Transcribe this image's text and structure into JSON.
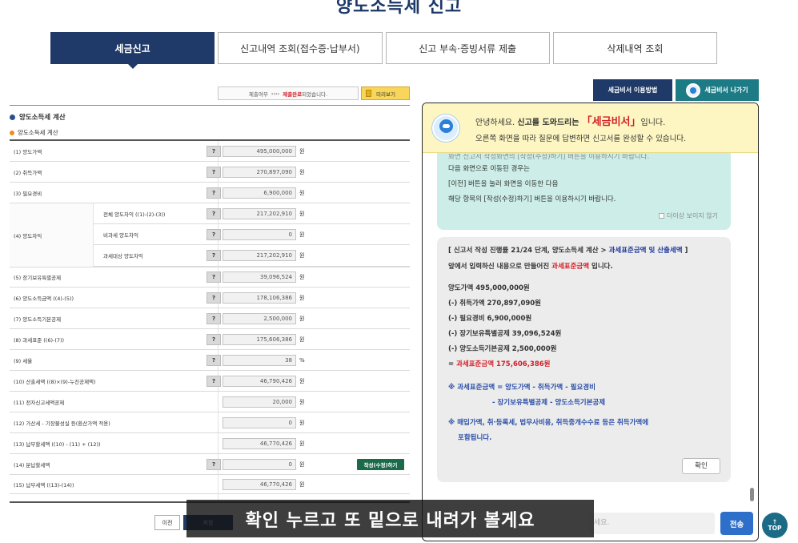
{
  "page": {
    "title": "양도소득세 신고"
  },
  "tabs": [
    {
      "label": "세금신고"
    },
    {
      "label": "신고내역 조회(접수증·납부서)"
    },
    {
      "label": "신고 부속·증빙서류 제출"
    },
    {
      "label": "삭제내역 조회"
    }
  ],
  "status": {
    "prefix": "제출여부",
    "arrows": "››››",
    "done": "제출완료",
    "suffix": "되었습니다."
  },
  "preview_label": "미리보기",
  "section_title": "양도소득세 계산",
  "sub_title": "양도소득세 계산",
  "form": {
    "rows": [
      {
        "label": "(1) 양도가액",
        "value": "495,000,000",
        "unit": "원"
      },
      {
        "label": "(2) 취득가액",
        "value": "270,897,090",
        "unit": "원"
      },
      {
        "label": "(3) 필요경비",
        "value": "6,900,000",
        "unit": "원"
      },
      {
        "label": "(4) 양도차익"
      },
      {
        "sublabel": "전체 양도차익 ((1)-(2)-(3))",
        "value": "217,202,910",
        "unit": "원"
      },
      {
        "sublabel": "비과세 양도차익",
        "value": "0",
        "unit": "원"
      },
      {
        "sublabel": "과세대상 양도차익",
        "value": "217,202,910",
        "unit": "원"
      },
      {
        "label": "(5) 장기보유특별공제",
        "value": "39,096,524",
        "unit": "원"
      },
      {
        "label": "(6) 양도소득금액 ((4)-(5))",
        "value": "178,106,386",
        "unit": "원"
      },
      {
        "label": "(7) 양도소득기본공제",
        "value": "2,500,000",
        "unit": "원"
      },
      {
        "label": "(8) 과세표준 ((6)-(7))",
        "value": "175,606,386",
        "unit": "원"
      },
      {
        "label": "(9) 세율",
        "value": "38",
        "unit": "%"
      },
      {
        "label": "(10) 산출세액 ((8)×(9)-누진공제액)",
        "value": "46,790,426",
        "unit": "원"
      },
      {
        "label": "(11) 전자신고세액공제",
        "value": "20,000",
        "unit": "원"
      },
      {
        "label": "(12) 가산세 - 기장불성실 등(환산가액 적용)",
        "value": "0",
        "unit": "원"
      },
      {
        "label": "(13) 납부할세액 ((10) - (11) + (12))",
        "value": "46,770,426",
        "unit": "원"
      },
      {
        "label": "(14) 분납할세액",
        "value": "0",
        "unit": "원",
        "action": "작성(수정)하기"
      },
      {
        "label": "(15) 납부세액 ((13)-(14))",
        "value": "46,770,426",
        "unit": "원"
      }
    ],
    "help_label": "?"
  },
  "nav": {
    "prev": "이전",
    "next": "저장"
  },
  "right": {
    "guide_button": "세금비서 이용방법",
    "exit_button": "세금비서 나가기",
    "header": {
      "greet": "안녕하세요.",
      "help": "신고를 도와드리는",
      "brand": "「세금비서」",
      "end": "입니다.",
      "line2": "오른쪽 화면을 따라 질문에 답변하면 신고서를 완성할 수 있습니다."
    },
    "teal_bubble": {
      "faded": "화면 신고서 작성화면의 [작성(수정)하기] 버튼을 이용하시기 바랍니다.",
      "line1": "다음 화면으로 이동된 경우는",
      "line2": "[이전] 버튼을 눌러 화면을 이동한 다음",
      "line3": "해당 항목의 [작성(수정)하기] 버튼을 이용하시기 바랍니다.",
      "no_more": "더이상 보이지 않기"
    },
    "grey_bubble": {
      "step_prefix": "[ 신고서 작성 진행률 21/24 단계, 양도소득세 계산 > ",
      "step_link": "과세표준금액 및 산출세액",
      "step_suffix": " ]",
      "intro_prefix": "앞에서 입력하신 내용으로 만들어진 ",
      "intro_red": "과세표준금액",
      "intro_suffix": " 입니다.",
      "calc": [
        "양도가액 495,000,000원",
        "(-) 취득가액 270,897,090원",
        "(-) 필요경비 6,900,000원",
        "(-) 장기보유특별공제 39,096,524원",
        "(-) 양도소득기본공제 2,500,000원"
      ],
      "result_prefix": "= ",
      "result": "과세표준금액 175,606,386원",
      "note1_a": "※ 과세표준금액 = 양도가액 - 취득가액 - 필요경비",
      "note1_b": "- 장기보유특별공제 - 양도소득기본공제",
      "note2_a": "※ 매입가액, 취·등록세, 법무사비용, 취득중개수수료 등은 취득가액에",
      "note2_b": "포함됩니다.",
      "ok": "확인"
    },
    "input_placeholder": "세요.",
    "send": "전송"
  },
  "top_button": "TOP",
  "subtitle": "확인 누르고 또 밑으로 내려가 볼게요",
  "colors": {
    "navy": "#1f3a68",
    "teal": "#1d7b86",
    "red": "#d21f26",
    "green": "#1b6a4a"
  }
}
